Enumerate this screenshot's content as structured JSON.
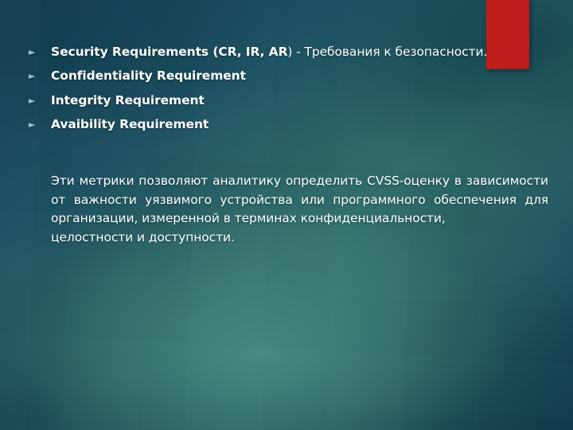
{
  "slide": {
    "accent_color": "#bf1c1c",
    "background_colors": [
      "#153f52",
      "#1d5263",
      "#2f6d69",
      "#1e5060",
      "#143e4e"
    ],
    "text_color": "#ffffff",
    "bullet_marker_color": "#9fc6cb",
    "bullet_glyph": "►"
  },
  "bullets": [
    {
      "marker": "►",
      "bold_part": "Security Requirements (CR, IR, AR",
      "normal_part": ") - Требования к безопасности.",
      "full_text": "Security Requirements (CR, IR, AR) - Требования к безопасности."
    },
    {
      "marker": "►",
      "bold_part": "Confidentiality Requirement",
      "normal_part": "",
      "full_text": "Confidentiality Requirement"
    },
    {
      "marker": "►",
      "bold_part": "Integrity Requirement",
      "normal_part": "",
      "full_text": "Integrity Requirement"
    },
    {
      "marker": "►",
      "bold_part": "Avaibility Requirement",
      "normal_part": "",
      "full_text": "Avaibility Requirement"
    }
  ],
  "paragraph": {
    "body": " Эти метрики позволяют аналитику определить CVSS-оценку в зависимости от важности уязвимого устройства или программного обеспечения для организации, измеренной в терминах конфиденциальности,",
    "last_line": "целостности и доступности."
  }
}
